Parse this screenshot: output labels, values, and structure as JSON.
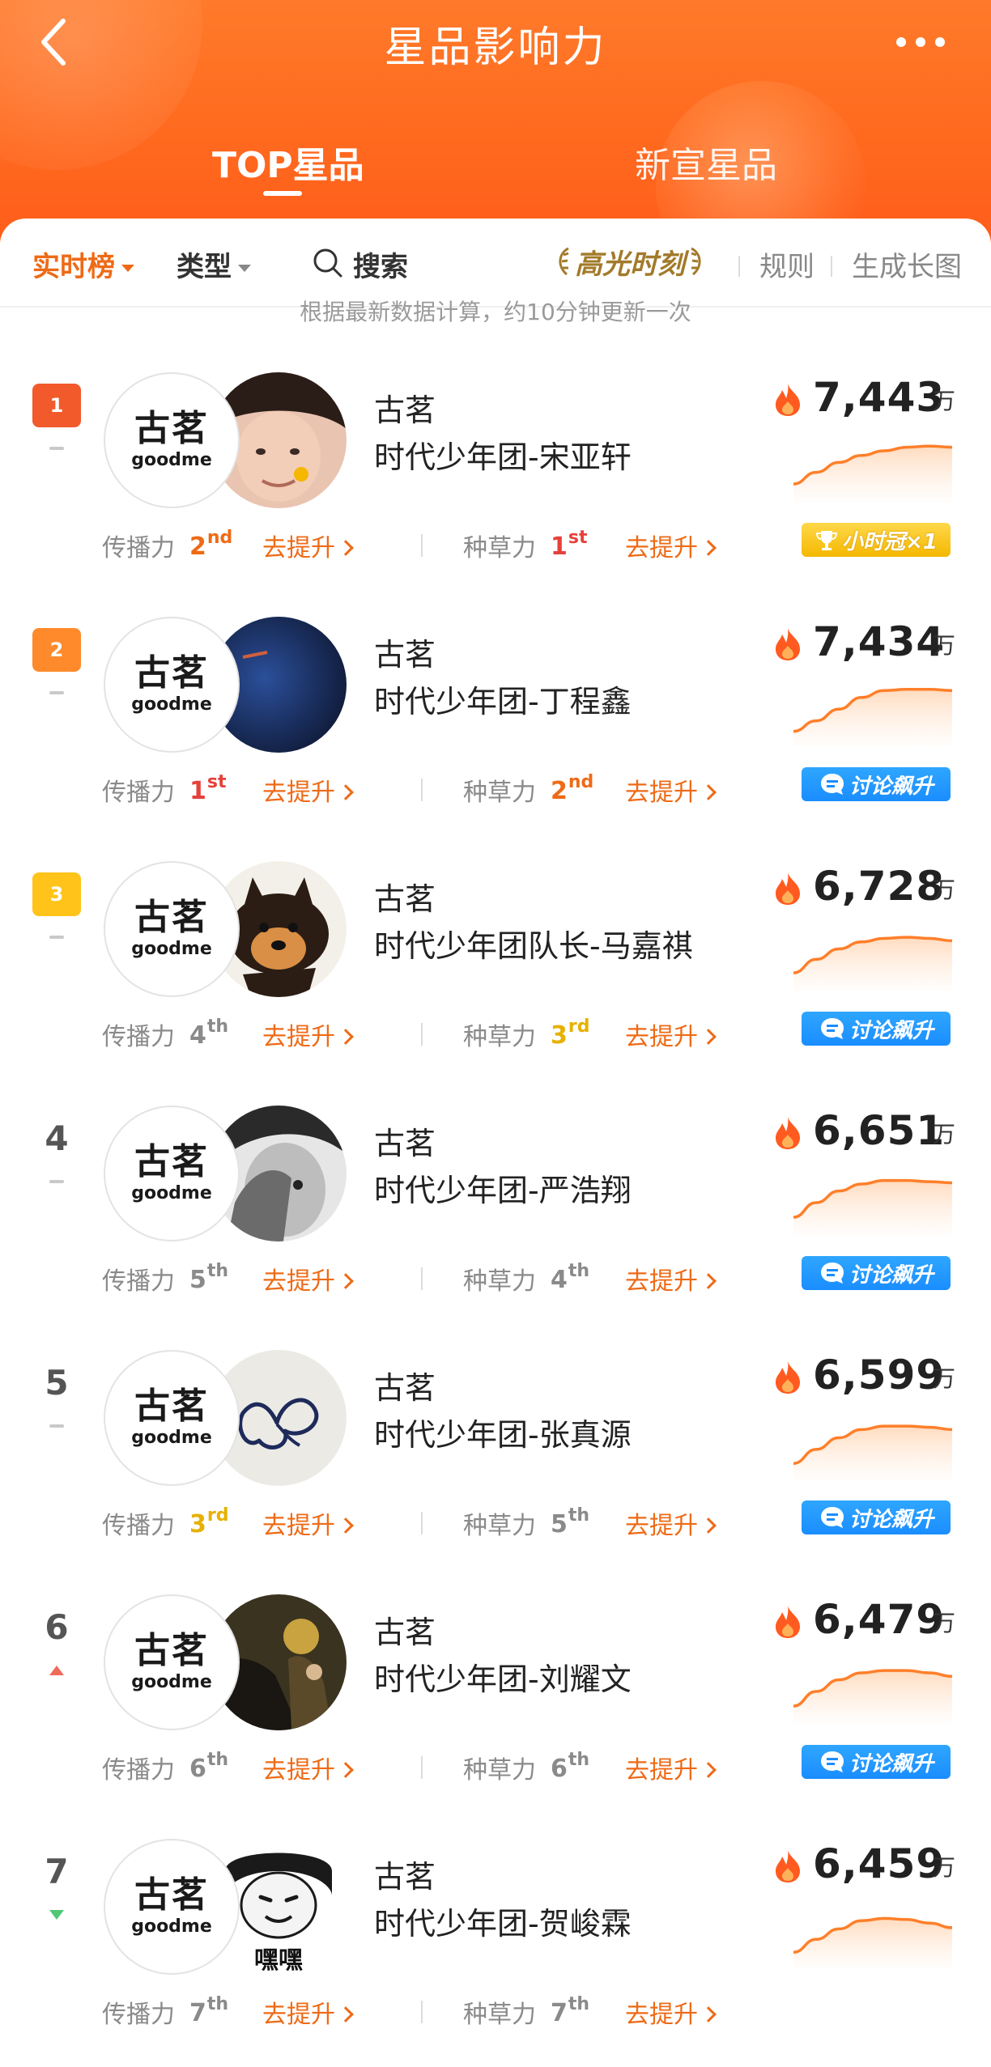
{
  "header": {
    "title": "星品影响力",
    "tabs": [
      {
        "label": "TOP星品",
        "active": true
      },
      {
        "label": "新宣星品",
        "active": false
      }
    ]
  },
  "filters": {
    "realtime": "实时榜",
    "type": "类型",
    "search": "搜索",
    "highlight": "高光时刻",
    "rules": "规则",
    "generate": "生成长图"
  },
  "note": "根据最新数据计算，约10分钟更新一次",
  "metric_labels": {
    "spread": "传播力",
    "seeding": "种草力",
    "improve": "去提升"
  },
  "colors": {
    "accent": "#ee6a16",
    "header": "#ff6a1f",
    "rank1": "#f25a2b",
    "rank2": "#ff8a2b",
    "rank3": "#ffc31a",
    "ordinal_first": "#e5413a",
    "ordinal_second": "#ee6a16",
    "ordinal_third": "#e6b100",
    "ordinal_other": "#8a8a8a"
  },
  "unit": "万",
  "items": [
    {
      "rank": "1",
      "trend": "flat",
      "brand": "古茗",
      "brand_en": "goodme",
      "product": "时代少年团-宋亚轩",
      "score": "7,443",
      "spread_rank": "2",
      "spread_suffix": "nd",
      "seed_rank": "1",
      "seed_suffix": "st",
      "tag": "小时冠×1",
      "tag_type": "trophy",
      "trend_values": [
        0.25,
        0.45,
        0.62,
        0.74,
        0.82,
        0.88,
        0.9,
        0.88
      ]
    },
    {
      "rank": "2",
      "trend": "flat",
      "brand": "古茗",
      "brand_en": "goodme",
      "product": "时代少年团-丁程鑫",
      "score": "7,434",
      "spread_rank": "1",
      "spread_suffix": "st",
      "seed_rank": "2",
      "seed_suffix": "nd",
      "tag": "讨论飙升",
      "tag_type": "discuss",
      "trend_values": [
        0.2,
        0.38,
        0.58,
        0.78,
        0.9,
        0.92,
        0.92,
        0.9
      ]
    },
    {
      "rank": "3",
      "trend": "flat",
      "brand": "古茗",
      "brand_en": "goodme",
      "product": "时代少年团队长-马嘉祺",
      "score": "6,728",
      "spread_rank": "4",
      "spread_suffix": "th",
      "seed_rank": "3",
      "seed_suffix": "rd",
      "tag": "讨论飙升",
      "tag_type": "discuss",
      "trend_values": [
        0.25,
        0.48,
        0.66,
        0.78,
        0.84,
        0.86,
        0.84,
        0.8
      ]
    },
    {
      "rank": "4",
      "trend": "flat",
      "brand": "古茗",
      "brand_en": "goodme",
      "product": "时代少年团-严浩翔",
      "score": "6,651",
      "spread_rank": "5",
      "spread_suffix": "th",
      "seed_rank": "4",
      "seed_suffix": "th",
      "tag": "讨论飙升",
      "tag_type": "discuss",
      "trend_values": [
        0.25,
        0.5,
        0.7,
        0.82,
        0.88,
        0.88,
        0.86,
        0.84
      ]
    },
    {
      "rank": "5",
      "trend": "flat",
      "brand": "古茗",
      "brand_en": "goodme",
      "product": "时代少年团-张真源",
      "score": "6,599",
      "spread_rank": "3",
      "spread_suffix": "rd",
      "seed_rank": "5",
      "seed_suffix": "th",
      "tag": "讨论飙升",
      "tag_type": "discuss",
      "trend_values": [
        0.22,
        0.46,
        0.66,
        0.8,
        0.86,
        0.86,
        0.84,
        0.8
      ]
    },
    {
      "rank": "6",
      "trend": "up",
      "brand": "古茗",
      "brand_en": "goodme",
      "product": "时代少年团-刘耀文",
      "score": "6,479",
      "spread_rank": "6",
      "spread_suffix": "th",
      "seed_rank": "6",
      "seed_suffix": "th",
      "tag": "讨论飙升",
      "tag_type": "discuss",
      "trend_values": [
        0.25,
        0.5,
        0.7,
        0.82,
        0.86,
        0.86,
        0.82,
        0.76
      ]
    },
    {
      "rank": "7",
      "trend": "down",
      "brand": "古茗",
      "brand_en": "goodme",
      "product": "时代少年团-贺峻霖",
      "score": "6,459",
      "spread_rank": "7",
      "spread_suffix": "th",
      "seed_rank": "7",
      "seed_suffix": "th",
      "tag": "",
      "tag_type": "none",
      "trend_values": [
        0.22,
        0.44,
        0.62,
        0.76,
        0.8,
        0.78,
        0.72,
        0.64
      ]
    }
  ]
}
